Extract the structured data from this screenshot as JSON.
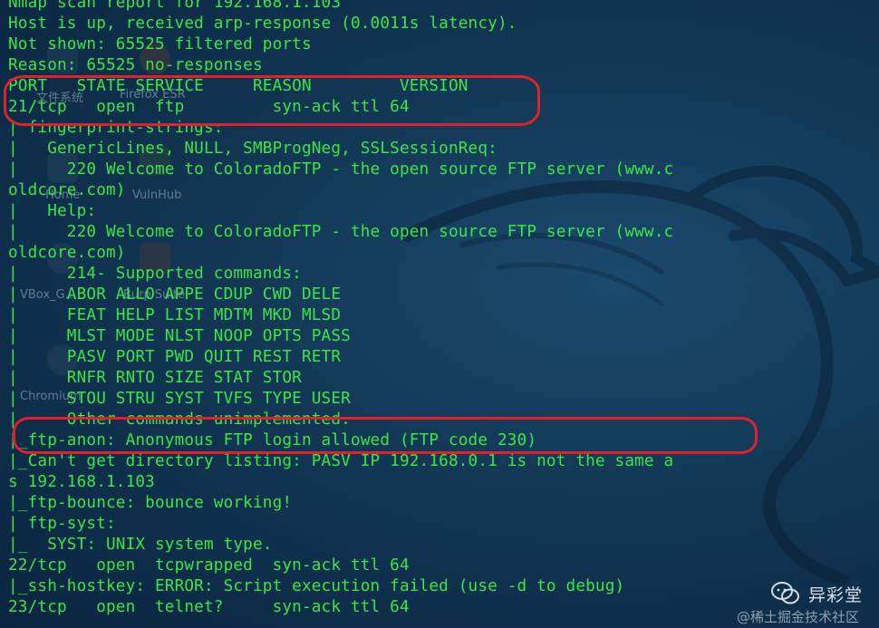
{
  "terminal": {
    "lines": [
      "Nmap scan report for 192.168.1.103",
      "Host is up, received arp-response (0.0011s latency).",
      "Not shown: 65525 filtered ports",
      "Reason: 65525 no-responses",
      "PORT   STATE SERVICE     REASON         VERSION",
      "21/tcp   open  ftp         syn-ack ttl 64",
      "| fingerprint-strings:",
      "|   GenericLines, NULL, SMBProgNeg, SSLSessionReq:",
      "|     220 Welcome to ColoradoFTP - the open source FTP server (www.c",
      "oldcore.com)",
      "|   Help:",
      "|     220 Welcome to ColoradoFTP - the open source FTP server (www.c",
      "oldcore.com)",
      "|     214- Supported commands:",
      "|     ABOR ALLO APPE CDUP CWD DELE",
      "|     FEAT HELP LIST MDTM MKD MLSD",
      "|     MLST MODE NLST NOOP OPTS PASS",
      "|     PASV PORT PWD QUIT REST RETR",
      "|     RNFR RNTO SIZE STAT STOR",
      "|     STOU STRU SYST TVFS TYPE USER",
      "|     Other commands unimplemented.",
      "|_ftp-anon: Anonymous FTP login allowed (FTP code 230)",
      "|_Can't get directory listing: PASV IP 192.168.0.1 is not the same a",
      "s 192.168.1.103",
      "|_ftp-bounce: bounce working!",
      "| ftp-syst:",
      "|_  SYST: UNIX system type.",
      "22/tcp   open  tcpwrapped  syn-ack ttl 64",
      "|_ssh-hostkey: ERROR: Script execution failed (use -d to debug)",
      "23/tcp   open  telnet?     syn-ack ttl 64"
    ]
  },
  "desktop_icons": [
    {
      "label": "文件系统",
      "icon": "folder-icon"
    },
    {
      "label": "Firefox ESR",
      "icon": "firefox-icon"
    },
    {
      "label": "Home",
      "icon": "home-icon"
    },
    {
      "label": "VulnHub",
      "icon": "vulnhub-icon"
    },
    {
      "label": "VBox_G...",
      "icon": "vbox-icon"
    },
    {
      "label": "Burp Suite",
      "icon": "burp-icon"
    },
    {
      "label": "Chromium",
      "icon": "chromium-icon"
    }
  ],
  "watermark": {
    "brand": "异彩堂",
    "sub": "@稀土掘金技术社区"
  },
  "colors": {
    "terminal_text": "#39e646",
    "highlight": "#e0202a",
    "background": "#123754"
  }
}
